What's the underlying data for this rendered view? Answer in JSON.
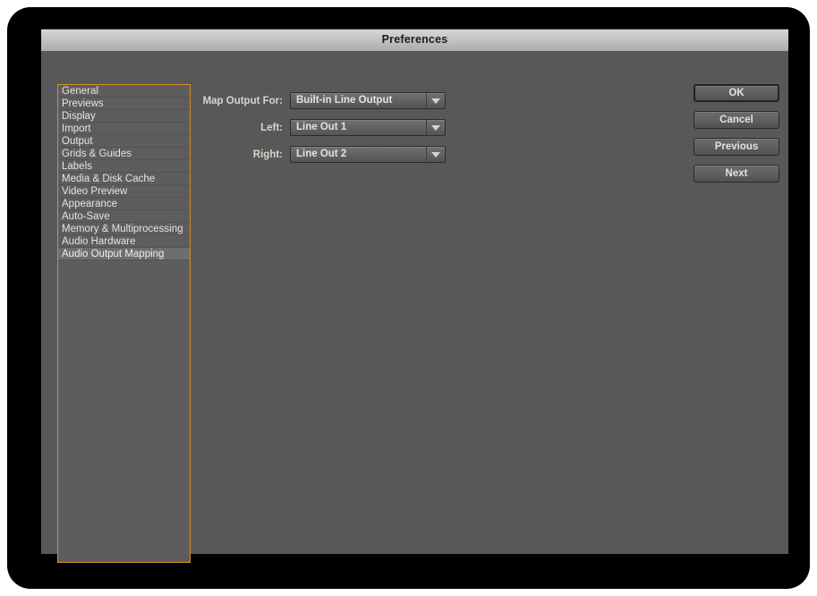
{
  "window": {
    "title": "Preferences"
  },
  "sidebar": {
    "name": "preferences-category-list",
    "items": [
      {
        "label": "General",
        "selected": false
      },
      {
        "label": "Previews",
        "selected": false
      },
      {
        "label": "Display",
        "selected": false
      },
      {
        "label": "Import",
        "selected": false
      },
      {
        "label": "Output",
        "selected": false
      },
      {
        "label": "Grids & Guides",
        "selected": false
      },
      {
        "label": "Labels",
        "selected": false
      },
      {
        "label": "Media & Disk Cache",
        "selected": false
      },
      {
        "label": "Video Preview",
        "selected": false
      },
      {
        "label": "Appearance",
        "selected": false
      },
      {
        "label": "Auto-Save",
        "selected": false
      },
      {
        "label": "Memory & Multiprocessing",
        "selected": false
      },
      {
        "label": "Audio Hardware",
        "selected": false
      },
      {
        "label": "Audio Output Mapping",
        "selected": true
      }
    ]
  },
  "form": {
    "rows": [
      {
        "label": "Map Output For:",
        "value": "Built-in Line Output",
        "icon": "chevron-down-icon"
      },
      {
        "label": "Left:",
        "value": "Line Out 1",
        "icon": "chevron-down-icon"
      },
      {
        "label": "Right:",
        "value": "Line Out 2",
        "icon": "chevron-down-icon"
      }
    ]
  },
  "buttons": {
    "ok": "OK",
    "cancel": "Cancel",
    "previous": "Previous",
    "next": "Next"
  },
  "colors": {
    "dialog_background": "#585858",
    "list_background": "#5d5d5d",
    "list_border_accent": "#d89020",
    "selected_row": "#6e6e6e",
    "text": "#e6e2da",
    "titlebar_text": "#1d1d1d",
    "bezel": "#000000"
  }
}
